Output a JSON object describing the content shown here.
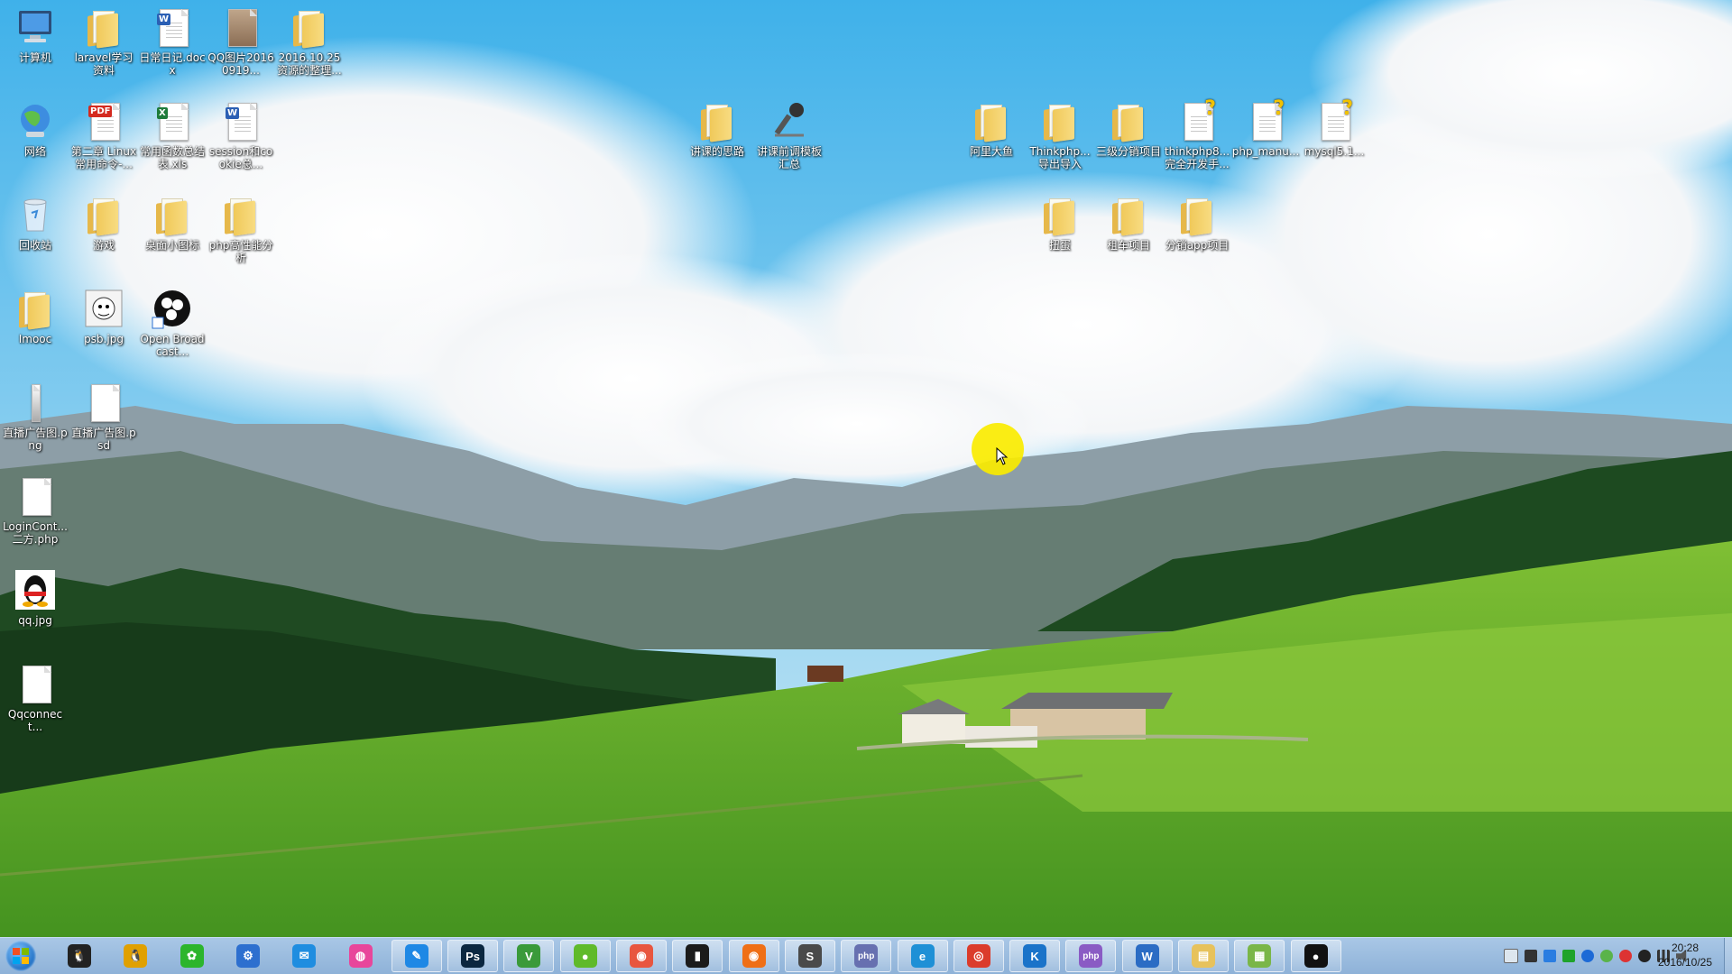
{
  "desktop": {
    "icons": [
      {
        "label": "计算机",
        "type": "computer"
      },
      {
        "label": "laravel学习资料",
        "type": "folder"
      },
      {
        "label": "日常日记.docx",
        "type": "word"
      },
      {
        "label": "QQ图片20160919...",
        "type": "image"
      },
      {
        "label": "2016.10.25 资源的整理...",
        "type": "folder"
      },
      {
        "label": "网络",
        "type": "network"
      },
      {
        "label": "第二章 Linux 常用命令-...",
        "type": "pdf"
      },
      {
        "label": "常用函数总结表.xls",
        "type": "excel"
      },
      {
        "label": "session和cookie总...",
        "type": "word"
      },
      {
        "label": "回收站",
        "type": "recycle"
      },
      {
        "label": "游戏",
        "type": "folder"
      },
      {
        "label": "桌面小图标",
        "type": "folder"
      },
      {
        "label": "php高性能分析",
        "type": "folder"
      },
      {
        "label": "Imooc",
        "type": "folder"
      },
      {
        "label": "psb.jpg",
        "type": "image-face"
      },
      {
        "label": "Open Broadcast...",
        "type": "obs"
      },
      {
        "label": "直播广告图.png",
        "type": "png"
      },
      {
        "label": "直播广告图.psd",
        "type": "blank"
      },
      {
        "label": "LoginCont...二方.php",
        "type": "blank"
      },
      {
        "label": "qq.jpg",
        "type": "qq"
      },
      {
        "label": "Qqconnect...",
        "type": "blank"
      },
      {
        "label": "讲课的思路",
        "type": "folder"
      },
      {
        "label": "讲课前调模板汇总",
        "type": "mic"
      },
      {
        "label": "阿里大鱼",
        "type": "folder"
      },
      {
        "label": "Thinkphp...导出导入",
        "type": "folder"
      },
      {
        "label": "三级分销项目",
        "type": "folder"
      },
      {
        "label": "thinkphp8...完全开发手...",
        "type": "help"
      },
      {
        "label": "php_manu...",
        "type": "help"
      },
      {
        "label": "mysql5.1...",
        "type": "help"
      },
      {
        "label": "扭蛋",
        "type": "folder"
      },
      {
        "label": "租车项目",
        "type": "folder"
      },
      {
        "label": "分销app项目",
        "type": "folder"
      }
    ]
  },
  "taskbar": {
    "apps": [
      {
        "name": "qq",
        "text": "🐧",
        "color": "#222222"
      },
      {
        "name": "qq-2",
        "text": "🐧",
        "color": "#e0a000"
      },
      {
        "name": "wechat",
        "text": "✿",
        "color": "#2cb52c"
      },
      {
        "name": "network-tool",
        "text": "⚙",
        "color": "#2d6fcf"
      },
      {
        "name": "store",
        "text": "✉",
        "color": "#1f8de0"
      },
      {
        "name": "media",
        "text": "◍",
        "color": "#e8469b"
      },
      {
        "name": "edit-tool",
        "text": "✎",
        "color": "#1e88e5"
      },
      {
        "name": "photoshop",
        "text": "Ps",
        "color": "#0b2740"
      },
      {
        "name": "vim",
        "text": "V",
        "color": "#3a9a3a"
      },
      {
        "name": "browser-green",
        "text": "●",
        "color": "#5fba2a"
      },
      {
        "name": "snail",
        "text": "◉",
        "color": "#e8563f"
      },
      {
        "name": "terminal",
        "text": "▮",
        "color": "#1b1b1b"
      },
      {
        "name": "firefox",
        "text": "◉",
        "color": "#ef6f16"
      },
      {
        "name": "sublime",
        "text": "S",
        "color": "#4a4a4a"
      },
      {
        "name": "php-tool",
        "text": "php",
        "color": "#6770b0"
      },
      {
        "name": "ie",
        "text": "e",
        "color": "#1e90d6"
      },
      {
        "name": "chrome",
        "text": "◎",
        "color": "#db3c2c"
      },
      {
        "name": "k-app",
        "text": "K",
        "color": "#1a73c9"
      },
      {
        "name": "phpstorm",
        "text": "php",
        "color": "#8a5bc4"
      },
      {
        "name": "word",
        "text": "W",
        "color": "#2b6cc4"
      },
      {
        "name": "explorer",
        "text": "▤",
        "color": "#e7c25c"
      },
      {
        "name": "chart-app",
        "text": "▦",
        "color": "#7ab648"
      },
      {
        "name": "obs",
        "text": "●",
        "color": "#111111"
      }
    ],
    "clock": {
      "time": "20:28",
      "date": "2016/10/25"
    }
  }
}
